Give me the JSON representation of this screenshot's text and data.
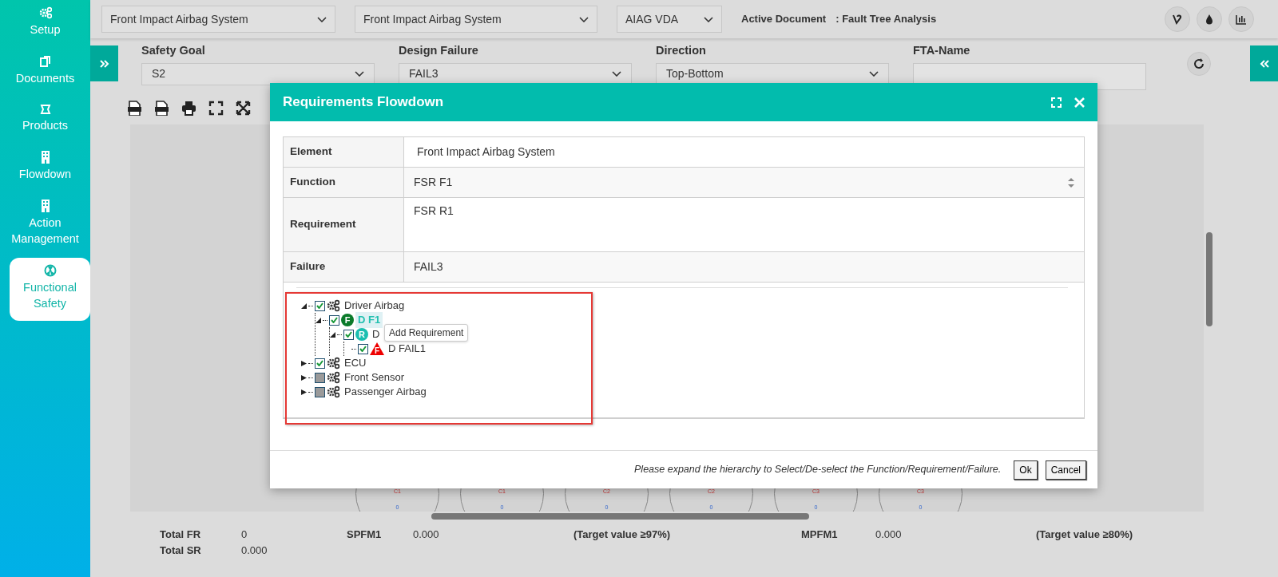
{
  "sidebar": {
    "items": [
      {
        "label": "Setup",
        "selected": false
      },
      {
        "label": "Documents",
        "selected": false
      },
      {
        "label": "Products",
        "selected": false
      },
      {
        "label": "Flowdown",
        "selected": false
      },
      {
        "label": "Action Management",
        "selected": false
      },
      {
        "label": "Functional Safety",
        "selected": true
      }
    ]
  },
  "top_bar": {
    "selects": [
      {
        "value": "Front Impact Airbag System"
      },
      {
        "value": "Front Impact Airbag System"
      },
      {
        "value": "AIAG VDA"
      }
    ],
    "active_document": {
      "label": "Active Document",
      "value": ": Fault Tree Analysis"
    }
  },
  "filters": [
    {
      "label": "Safety Goal",
      "kind": "select",
      "value": "S2"
    },
    {
      "label": "Design Failure",
      "kind": "select",
      "value": "FAIL3"
    },
    {
      "label": "Direction",
      "kind": "select",
      "value": "Top-Bottom"
    },
    {
      "label": "FTA-Name",
      "kind": "text"
    }
  ],
  "diagram_nodes": [
    {
      "label": "C1",
      "value": "0"
    },
    {
      "label": "C1",
      "value": "0"
    },
    {
      "label": "C2",
      "value": "0"
    },
    {
      "label": "C2",
      "value": "0"
    },
    {
      "label": "C3",
      "value": "0"
    },
    {
      "label": "C3",
      "value": "0"
    }
  ],
  "summary": {
    "rows": [
      [
        {
          "label": "Total FR",
          "value": "0"
        },
        {
          "label": "SPFM1",
          "value": "0.000",
          "note": "(Target value ≥97%)"
        },
        {
          "label": "MPFM1",
          "value": "0.000",
          "note": "(Target value ≥80%)"
        }
      ],
      [
        {
          "label": "Total SR",
          "value": "0.000"
        }
      ]
    ]
  },
  "modal": {
    "title": "Requirements Flowdown",
    "fields": [
      {
        "label": "Element",
        "kind": "text",
        "value": "Front Impact Airbag System"
      },
      {
        "label": "Function",
        "kind": "select",
        "value": "FSR F1"
      },
      {
        "label": "Requirement",
        "kind": "textarea",
        "value": "FSR R1"
      },
      {
        "label": "Failure",
        "kind": "readonly",
        "value": "FAIL3"
      }
    ],
    "tree": [
      {
        "label": "Driver Airbag",
        "kind": "component",
        "checked": true,
        "expanded": true,
        "selected": false,
        "children": [
          {
            "label": "D F1",
            "kind": "function",
            "badge": "F",
            "checked": true,
            "expanded": true,
            "selected": true,
            "children": [
              {
                "label": "D",
                "kind": "requirement",
                "badge": "R",
                "checked": true,
                "expanded": true,
                "selected": false,
                "children": [
                  {
                    "label": "D FAIL1",
                    "kind": "failure",
                    "badge": "F",
                    "checked": true,
                    "selected": false
                  }
                ]
              }
            ]
          }
        ]
      },
      {
        "label": "ECU",
        "kind": "component",
        "checked": true,
        "expanded": false,
        "selected": false
      },
      {
        "label": "Front Sensor",
        "kind": "component",
        "checked": false,
        "expanded": false,
        "selected": false
      },
      {
        "label": "Passenger Airbag",
        "kind": "component",
        "checked": false,
        "expanded": false,
        "selected": false
      }
    ],
    "tooltip": "Add Requirement",
    "note": "Please expand the hierarchy to Select/De-select the Function/Requirement/Failure.",
    "buttons": [
      "Ok",
      "Cancel"
    ]
  }
}
